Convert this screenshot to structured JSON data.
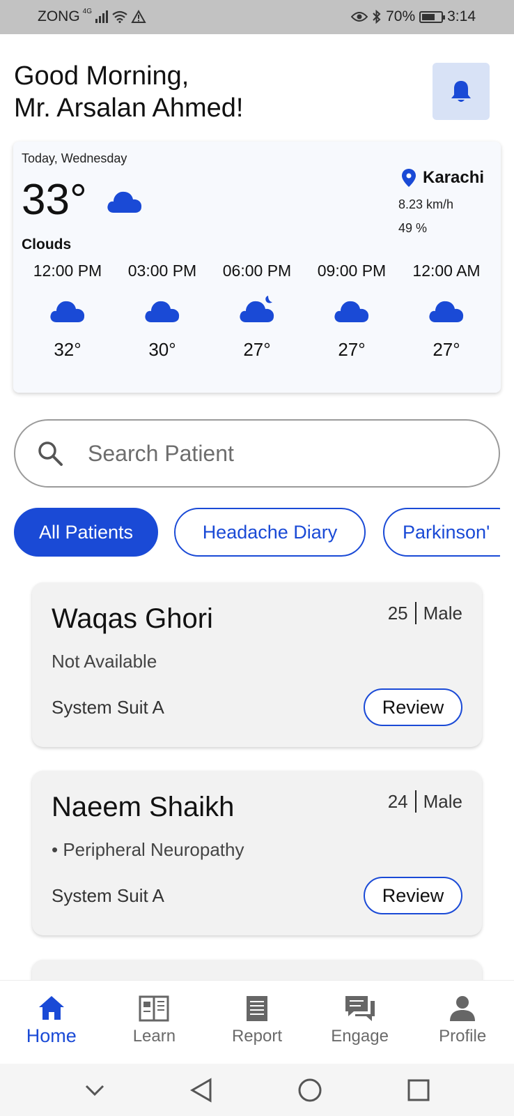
{
  "status_bar": {
    "carrier": "ZONG",
    "network_tag": "4G",
    "battery": "70%",
    "battery_level": 0.7,
    "time": "3:14"
  },
  "header": {
    "greeting_line1": "Good Morning,",
    "greeting_line2": "Mr. Arsalan Ahmed!"
  },
  "weather": {
    "day": "Today, Wednesday",
    "temperature": "33°",
    "condition": "Clouds",
    "city": "Karachi",
    "wind": "8.23 km/h",
    "humidity": "49 %",
    "forecast": [
      {
        "time": "12:00 PM",
        "temp": "32°",
        "icon": "cloud-icon"
      },
      {
        "time": "03:00 PM",
        "temp": "30°",
        "icon": "cloud-icon"
      },
      {
        "time": "06:00 PM",
        "temp": "27°",
        "icon": "cloud-night-icon"
      },
      {
        "time": "09:00 PM",
        "temp": "27°",
        "icon": "cloud-icon"
      },
      {
        "time": "12:00 AM",
        "temp": "27°",
        "icon": "cloud-icon"
      }
    ]
  },
  "search": {
    "placeholder": "Search Patient"
  },
  "filters": [
    {
      "label": "All Patients",
      "active": true
    },
    {
      "label": "Headache Diary",
      "active": false
    },
    {
      "label": "Parkinson'",
      "active": false
    }
  ],
  "patients": [
    {
      "name": "Waqas Ghori",
      "age": "25",
      "gender": "Male",
      "condition": "Not Available",
      "suite": "System Suit A",
      "action": "Review"
    },
    {
      "name": "Naeem Shaikh",
      "age": "24",
      "gender": "Male",
      "condition": "• Peripheral Neuropathy",
      "suite": "System Suit A",
      "action": "Review"
    }
  ],
  "bottom_nav": [
    {
      "label": "Home",
      "icon": "home-icon",
      "active": true
    },
    {
      "label": "Learn",
      "icon": "book-icon",
      "active": false
    },
    {
      "label": "Report",
      "icon": "report-icon",
      "active": false
    },
    {
      "label": "Engage",
      "icon": "chat-icon",
      "active": false
    },
    {
      "label": "Profile",
      "icon": "profile-icon",
      "active": false
    }
  ],
  "colors": {
    "primary": "#1a4ad6",
    "bell_bg": "#d8e2f6",
    "card_bg": "#f2f2f2",
    "status_bar": "#c2c2c2"
  }
}
